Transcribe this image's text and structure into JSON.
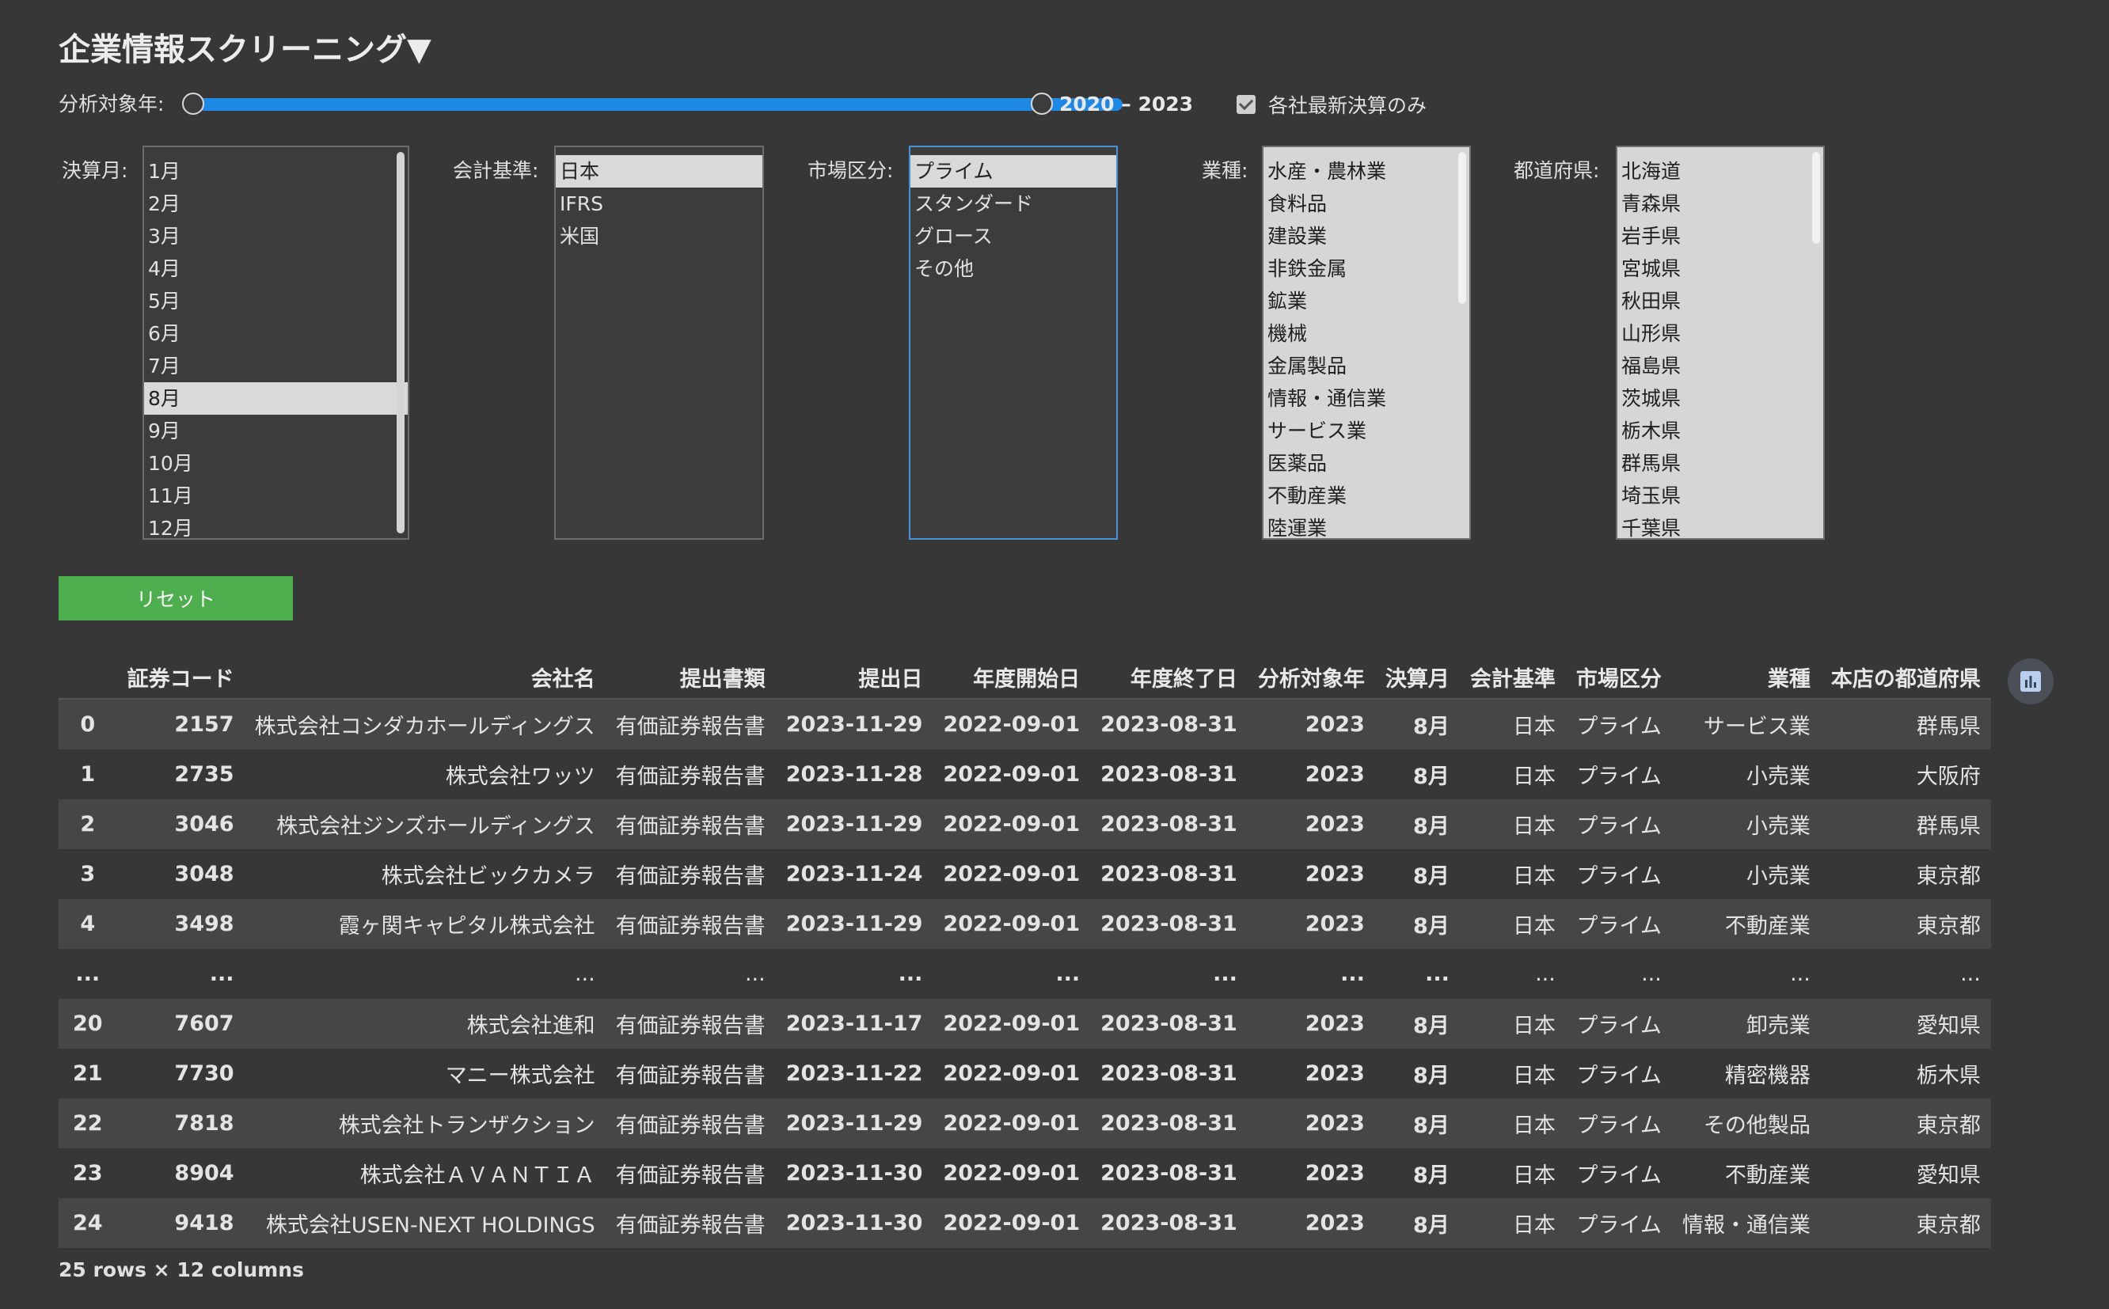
{
  "title": "企業情報スクリーニング▼",
  "slider": {
    "label": "分析対象年:",
    "value_text": "2020 – 2023",
    "range": [
      2020,
      2023
    ],
    "selected": [
      2020,
      2023
    ]
  },
  "checkbox": {
    "label": "各社最新決算のみ",
    "checked": true
  },
  "filters": {
    "month": {
      "label": "決算月:",
      "options": [
        "1月",
        "2月",
        "3月",
        "4月",
        "5月",
        "6月",
        "7月",
        "8月",
        "9月",
        "10月",
        "11月",
        "12月"
      ],
      "selected": "8月"
    },
    "standard": {
      "label": "会計基準:",
      "options": [
        "日本",
        "IFRS",
        "米国"
      ],
      "selected": "日本"
    },
    "market": {
      "label": "市場区分:",
      "options": [
        "プライム",
        "スタンダード",
        "グロース",
        "その他"
      ],
      "selected": "プライム"
    },
    "industry": {
      "label": "業種:",
      "options": [
        "水産・農林業",
        "食料品",
        "建設業",
        "非鉄金属",
        "鉱業",
        "機械",
        "金属製品",
        "情報・通信業",
        "サービス業",
        "医薬品",
        "不動産業",
        "陸運業"
      ]
    },
    "prefecture": {
      "label": "都道府県:",
      "options": [
        "北海道",
        "青森県",
        "岩手県",
        "宮城県",
        "秋田県",
        "山形県",
        "福島県",
        "茨城県",
        "栃木県",
        "群馬県",
        "埼玉県",
        "千葉県"
      ]
    }
  },
  "reset_label": "リセット",
  "table": {
    "headers": [
      "",
      "証券コード",
      "会社名",
      "提出書類",
      "提出日",
      "年度開始日",
      "年度終了日",
      "分析対象年",
      "決算月",
      "会計基準",
      "市場区分",
      "業種",
      "本店の都道府県"
    ],
    "rows": [
      [
        "0",
        "2157",
        "株式会社コシダカホールディングス",
        "有価証券報告書",
        "2023-11-29",
        "2022-09-01",
        "2023-08-31",
        "2023",
        "8月",
        "日本",
        "プライム",
        "サービス業",
        "群馬県"
      ],
      [
        "1",
        "2735",
        "株式会社ワッツ",
        "有価証券報告書",
        "2023-11-28",
        "2022-09-01",
        "2023-08-31",
        "2023",
        "8月",
        "日本",
        "プライム",
        "小売業",
        "大阪府"
      ],
      [
        "2",
        "3046",
        "株式会社ジンズホールディングス",
        "有価証券報告書",
        "2023-11-29",
        "2022-09-01",
        "2023-08-31",
        "2023",
        "8月",
        "日本",
        "プライム",
        "小売業",
        "群馬県"
      ],
      [
        "3",
        "3048",
        "株式会社ビックカメラ",
        "有価証券報告書",
        "2023-11-24",
        "2022-09-01",
        "2023-08-31",
        "2023",
        "8月",
        "日本",
        "プライム",
        "小売業",
        "東京都"
      ],
      [
        "4",
        "3498",
        "霞ヶ関キャピタル株式会社",
        "有価証券報告書",
        "2023-11-29",
        "2022-09-01",
        "2023-08-31",
        "2023",
        "8月",
        "日本",
        "プライム",
        "不動産業",
        "東京都"
      ],
      [
        "...",
        "...",
        "...",
        "...",
        "...",
        "...",
        "...",
        "...",
        "...",
        "...",
        "...",
        "...",
        "..."
      ],
      [
        "20",
        "7607",
        "株式会社進和",
        "有価証券報告書",
        "2023-11-17",
        "2022-09-01",
        "2023-08-31",
        "2023",
        "8月",
        "日本",
        "プライム",
        "卸売業",
        "愛知県"
      ],
      [
        "21",
        "7730",
        "マニー株式会社",
        "有価証券報告書",
        "2023-11-22",
        "2022-09-01",
        "2023-08-31",
        "2023",
        "8月",
        "日本",
        "プライム",
        "精密機器",
        "栃木県"
      ],
      [
        "22",
        "7818",
        "株式会社トランザクション",
        "有価証券報告書",
        "2023-11-29",
        "2022-09-01",
        "2023-08-31",
        "2023",
        "8月",
        "日本",
        "プライム",
        "その他製品",
        "東京都"
      ],
      [
        "23",
        "8904",
        "株式会社ＡＶＡＮＴＩＡ",
        "有価証券報告書",
        "2023-11-30",
        "2022-09-01",
        "2023-08-31",
        "2023",
        "8月",
        "日本",
        "プライム",
        "不動産業",
        "愛知県"
      ],
      [
        "24",
        "9418",
        "株式会社USEN-NEXT HOLDINGS",
        "有価証券報告書",
        "2023-11-30",
        "2022-09-01",
        "2023-08-31",
        "2023",
        "8月",
        "日本",
        "プライム",
        "情報・通信業",
        "東京都"
      ]
    ]
  },
  "footer": "25 rows × 12 columns"
}
